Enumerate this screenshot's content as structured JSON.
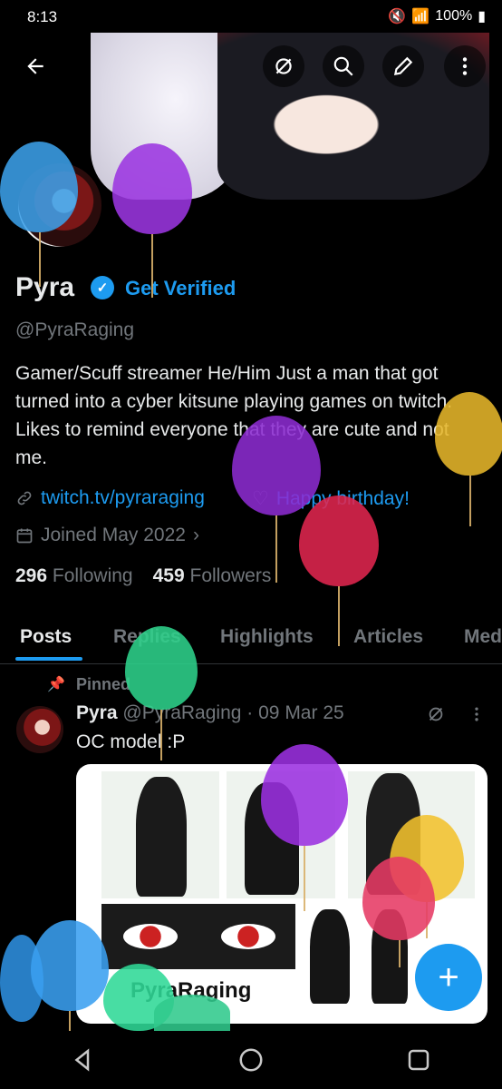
{
  "status_bar": {
    "time": "8:13",
    "battery": "100%"
  },
  "header": {
    "back_icon": "arrow-left-icon",
    "actions": [
      "hide-icon",
      "search-icon",
      "edit-icon",
      "more-vertical-icon"
    ]
  },
  "profile": {
    "name": "Pyra",
    "get_verified": "Get Verified",
    "handle": "@PyraRaging",
    "bio": "Gamer/Scuff streamer He/Him Just a man that got turned into a cyber kitsune playing games on twitch. Likes to remind everyone that they are cute and not me.",
    "link": "twitch.tv/pyraraging",
    "birthday": "Happy birthday!",
    "joined": "Joined May 2022",
    "following_count": "296",
    "following_label": "Following",
    "followers_count": "459",
    "followers_label": "Followers"
  },
  "tabs": [
    "Posts",
    "Replies",
    "Highlights",
    "Articles",
    "Media"
  ],
  "post": {
    "pinned_label": "Pinned",
    "author": "Pyra",
    "handle": "@PyraRaging",
    "date": "09 Mar 25",
    "text": "OC model :P",
    "image_caption": "PyraRaging"
  },
  "fab_icon": "plus-icon",
  "colors": {
    "accent": "#1d9bf0",
    "background": "#000000",
    "muted": "#71767b"
  }
}
